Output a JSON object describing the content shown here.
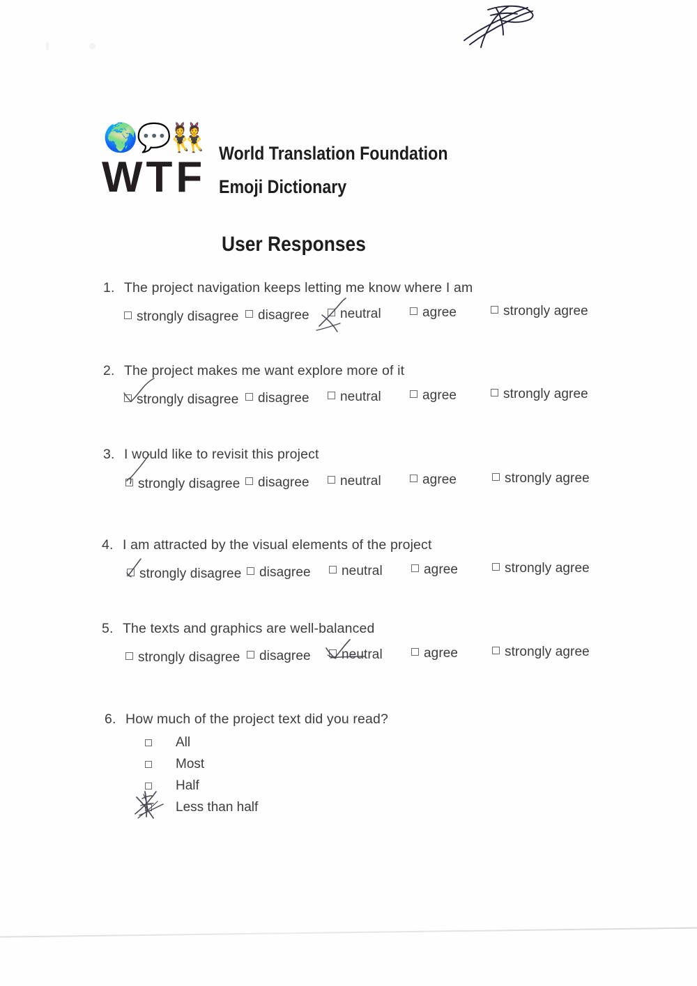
{
  "document": {
    "type": "scanned-survey-form",
    "organization": {
      "name_line1": "World Translation Foundation",
      "name_line2": "Emoji Dictionary",
      "acronym": "WTF",
      "emoji": [
        {
          "name": "globe-showing-europe-africa-emoji",
          "glyph": "🌍"
        },
        {
          "name": "speech-balloon-emoji",
          "glyph": "💬"
        },
        {
          "name": "people-with-bunny-ears-emoji",
          "glyph": "👯"
        }
      ]
    },
    "section_title": "User Responses",
    "annotations": {
      "signature_present": true,
      "ink_color": "#4a4a55"
    }
  },
  "likert_options": [
    "strongly disagree",
    "disagree",
    "neutral",
    "agree",
    "strongly agree"
  ],
  "questions": [
    {
      "number": "1.",
      "text": "The project navigation keeps letting me know where I am",
      "type": "likert",
      "options": [
        "strongly disagree",
        "disagree",
        "neutral",
        "agree",
        "strongly agree"
      ],
      "selected": "neutral",
      "selected_index": 2,
      "mark_style": "cross"
    },
    {
      "number": "2.",
      "text": "The project makes me want explore more of it",
      "type": "likert",
      "options": [
        "strongly disagree",
        "disagree",
        "neutral",
        "agree",
        "strongly agree"
      ],
      "selected": "strongly disagree",
      "selected_index": 0,
      "mark_style": "curved-check"
    },
    {
      "number": "3.",
      "text": "I would like to revisit this project",
      "type": "likert",
      "options": [
        "strongly disagree",
        "disagree",
        "neutral",
        "agree",
        "strongly agree"
      ],
      "selected": "strongly disagree",
      "selected_index": 0,
      "mark_style": "long-diagonal"
    },
    {
      "number": "4.",
      "text": "I am attracted by the visual elements of the project",
      "type": "likert",
      "options": [
        "strongly disagree",
        "disagree",
        "neutral",
        "agree",
        "strongly agree"
      ],
      "selected": "strongly disagree",
      "selected_index": 0,
      "mark_style": "short-slash"
    },
    {
      "number": "5.",
      "text": "The texts and graphics are well-balanced",
      "type": "likert",
      "options": [
        "strongly disagree",
        "disagree",
        "neutral",
        "agree",
        "strongly agree"
      ],
      "selected": "neutral",
      "selected_index": 2,
      "mark_style": "check-with-strikethrough"
    },
    {
      "number": "6.",
      "text": "How much of the project text did you read?",
      "type": "single-choice-vertical",
      "options": [
        "All",
        "Most",
        "Half",
        "Less than half"
      ],
      "selected": "Less than half",
      "selected_index": 3,
      "mark_style": "heavy-scribble"
    }
  ]
}
